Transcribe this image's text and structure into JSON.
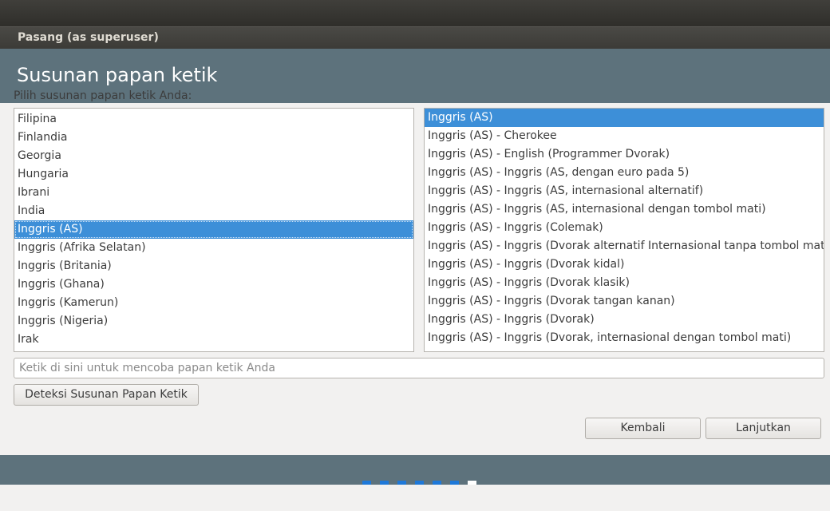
{
  "window": {
    "title": "Pasang (as superuser)"
  },
  "header": {
    "title": "Susunan papan ketik"
  },
  "prompt": "Pilih susunan papan ketik Anda:",
  "layouts": {
    "items": [
      "Filipina",
      "Finlandia",
      "Georgia",
      "Hungaria",
      "Ibrani",
      "India",
      "Inggris (AS)",
      "Inggris (Afrika Selatan)",
      "Inggris (Britania)",
      "Inggris (Ghana)",
      "Inggris (Kamerun)",
      "Inggris (Nigeria)",
      "Irak"
    ],
    "selected": "Inggris (AS)"
  },
  "variants": {
    "items": [
      "Inggris (AS)",
      "Inggris (AS) - Cherokee",
      "Inggris (AS) - English (Programmer Dvorak)",
      "Inggris (AS) - Inggris (AS, dengan euro pada 5)",
      "Inggris (AS) - Inggris (AS, internasional alternatif)",
      "Inggris (AS) - Inggris (AS, internasional dengan tombol mati)",
      "Inggris (AS) - Inggris (Colemak)",
      "Inggris (AS) - Inggris (Dvorak alternatif Internasional tanpa tombol mati)",
      "Inggris (AS) - Inggris (Dvorak kidal)",
      "Inggris (AS) - Inggris (Dvorak klasik)",
      "Inggris (AS) - Inggris (Dvorak tangan kanan)",
      "Inggris (AS) - Inggris (Dvorak)",
      "Inggris (AS) - Inggris (Dvorak, internasional dengan tombol mati)"
    ],
    "selected": "Inggris (AS)"
  },
  "test_input": {
    "value": "",
    "placeholder": "Ketik di sini untuk mencoba papan ketik Anda"
  },
  "buttons": {
    "detect": "Deteksi Susunan Papan Ketik",
    "back": "Kembali",
    "next": "Lanjutkan"
  },
  "progress": {
    "total_steps": 7,
    "current_step": 7
  },
  "colors": {
    "header": "#5d727c",
    "selection": "#3d8fd8",
    "progress_dot": "#1e78d8"
  }
}
